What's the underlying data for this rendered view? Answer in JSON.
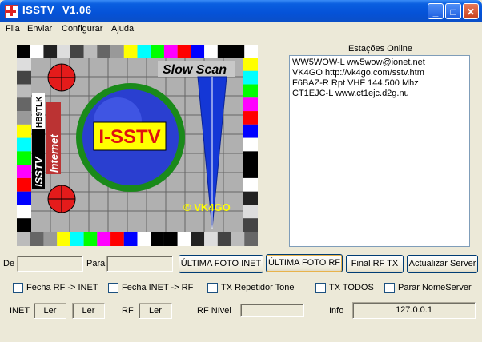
{
  "window": {
    "name": "ISSTV",
    "version": "V1.06"
  },
  "menu": [
    "Fila",
    "Enviar",
    "Configurar",
    "Ajuda"
  ],
  "testcard": {
    "slow_scan": "Slow Scan",
    "logo": "I-SSTV",
    "credit": "© VK4GO",
    "side_labels": [
      "ISSTV",
      "HB9TLK",
      "Internet"
    ]
  },
  "stations": {
    "title": "Estações Online",
    "items": [
      "WW5WOW-L   ww5wow@ionet.net",
      "VK4GO   http://vk4go.com/sstv.htm",
      "F6BAZ-R   Rpt VHF 144.500 Mhz",
      "CT1EJC-L   www.ct1ejc.d2g.nu"
    ]
  },
  "controls": {
    "de_label": "De",
    "de_value": "",
    "para_label": "Para",
    "para_value": "",
    "btn_ultima_inet": "ÚLTIMA FOTO INET",
    "btn_ultima_rf": "ÚLTIMA FOTO RF",
    "btn_final_rf_tx": "Final RF TX",
    "btn_actualizar": "Actualizar Server"
  },
  "checks": [
    {
      "label": "Fecha RF -> INET",
      "checked": false
    },
    {
      "label": "Fecha INET -> RF",
      "checked": false
    },
    {
      "label": "TX Repetidor Tone",
      "checked": false
    },
    {
      "label": "TX TODOS",
      "checked": false
    },
    {
      "label": "Parar NomeServer",
      "checked": false
    }
  ],
  "status": {
    "inet_label": "INET",
    "inet_values": [
      "Ler",
      "Ler"
    ],
    "rf_label": "RF",
    "rf_value": "Ler",
    "rf_level_label": "RF Nível",
    "rf_level": 0,
    "info_label": "Info",
    "info_value": "127.0.0.1"
  },
  "colors": {
    "title_blue": "#0552d8",
    "face": "#ece9d8"
  }
}
